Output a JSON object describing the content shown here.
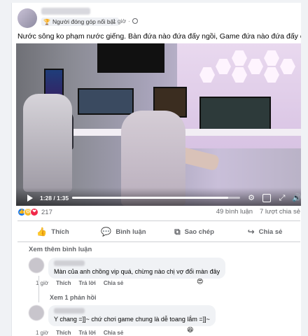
{
  "post": {
    "badge_label": "Người đóng góp nổi bật",
    "time": "1 giờ",
    "separator": "·",
    "text": "Nước sông ko phạm nước giếng. Bàn đứa nào đứa đấy ngồi, Game đứa nào đứa đấy chơi 🙎🏻‍♀️🙎🏻‍♂️"
  },
  "video": {
    "time_display": "1:28 / 1:35",
    "progress": 0.93
  },
  "stats": {
    "reaction_count": "217",
    "comments": "49 bình luận",
    "shares": "7 lượt chia sẻ"
  },
  "actions": {
    "like": "Thích",
    "comment": "Bình luận",
    "copy": "Sao chép",
    "share": "Chia sẻ"
  },
  "comments_section": {
    "more_label": "Xem thêm bình luận",
    "comment1": {
      "text": "Màn của anh chồng vip quá, chừng nào chị vợ đổi màn đây",
      "time": "1 giờ",
      "like": "Thích",
      "reply": "Trả lời",
      "share": "Chia sẻ",
      "reaction": "😍"
    },
    "view_replies": "Xem 1 phản hồi",
    "comment2": {
      "text": "Y chang =]]~ chứ chơi game chung là dễ toang lắm =]]~",
      "time": "1 giờ",
      "like": "Thích",
      "reply": "Trả lời",
      "share": "Chia sẻ",
      "reaction": "😆"
    }
  },
  "colors": {
    "primary_text": "#050505",
    "secondary_text": "#65676b",
    "like_blue": "#1877f2",
    "background": "#f0f2f5"
  }
}
